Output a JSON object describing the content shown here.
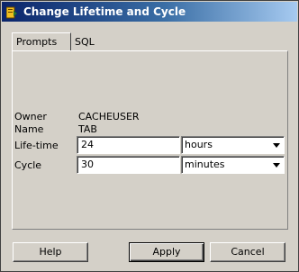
{
  "window": {
    "title": "Change Lifetime and Cycle",
    "title_colors": [
      "#0a246a",
      "#a6caf0"
    ]
  },
  "tabs": [
    {
      "label": "Prompts",
      "active": true
    },
    {
      "label": "SQL",
      "active": false
    }
  ],
  "form": {
    "owner_label": "Owner",
    "owner_value": "CACHEUSER",
    "name_label": "Name",
    "name_value": "TAB",
    "lifetime_label": "Life-time",
    "lifetime_value": "24",
    "lifetime_unit": "hours",
    "cycle_label": "Cycle",
    "cycle_value": "30",
    "cycle_unit": "minutes"
  },
  "buttons": {
    "help": "Help",
    "apply": "Apply",
    "cancel": "Cancel"
  }
}
